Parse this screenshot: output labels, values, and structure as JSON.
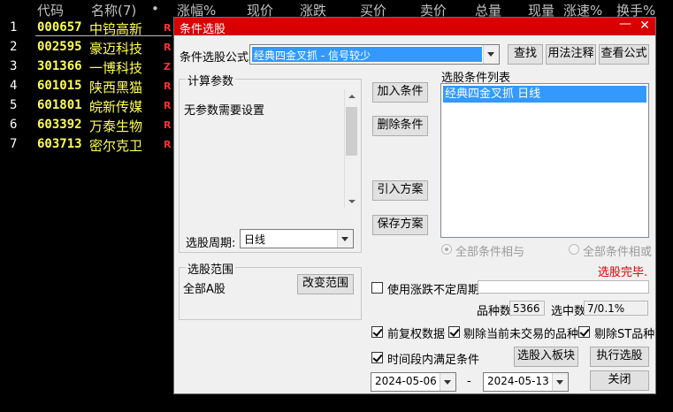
{
  "list_header": {
    "code": "代码",
    "name": "名称(7)",
    "dot": "•",
    "change_pct": "涨幅%",
    "price": "现价",
    "change": "涨跌",
    "bid": "买价",
    "ask": "卖价",
    "volume": "总量",
    "cur_volume": "现量",
    "speed": "涨速%",
    "turnover": "换手%"
  },
  "stocks": [
    {
      "idx": "1",
      "code": "000657",
      "name": "中钨高新",
      "flag": "R"
    },
    {
      "idx": "2",
      "code": "002595",
      "name": "豪迈科技",
      "flag": "R"
    },
    {
      "idx": "3",
      "code": "301366",
      "name": "一博科技",
      "flag": "Z"
    },
    {
      "idx": "4",
      "code": "601015",
      "name": "陕西黑猫",
      "flag": "R"
    },
    {
      "idx": "5",
      "code": "601801",
      "name": "皖新传媒",
      "flag": "R"
    },
    {
      "idx": "6",
      "code": "603392",
      "name": "万泰生物",
      "flag": "R"
    },
    {
      "idx": "7",
      "code": "603713",
      "name": "密尔克卫",
      "flag": "R"
    }
  ],
  "dialog": {
    "title": "条件选股",
    "minimize": "—",
    "close": "✕",
    "formula_label": "条件选股公式",
    "formula_value": "经典四金叉抓 - 信号较少",
    "find_btn": "查找",
    "usage_btn": "用法注释",
    "view_formula_btn": "查看公式",
    "params_group": "计算参数",
    "params_text": "无参数需要设置",
    "period_label": "选股周期:",
    "period_value": "日线",
    "add_cond_btn": "加入条件",
    "del_cond_btn": "删除条件",
    "import_plan_btn": "引入方案",
    "save_plan_btn": "保存方案",
    "cond_list_label": "选股条件列表",
    "cond_items": [
      "经典四金叉抓  日线"
    ],
    "radio_and": "全部条件相与",
    "radio_or": "全部条件相或",
    "status": "选股完毕.",
    "range_group": "选股范围",
    "range_value": "全部A股",
    "change_range_btn": "改变范围",
    "use_variable_period": "使用涨跌不定周期",
    "variable_period_value": "",
    "count_label": "品种数",
    "count_value": "5366",
    "selected_label": "选中数",
    "selected_value": "7/0.1%",
    "fq_label": "前复权数据",
    "exclude_untraded_label": "剔除当前未交易的品种",
    "exclude_st_label": "剔除ST品种",
    "time_range_label": "时间段内满足条件",
    "add_to_block_btn": "选股入板块",
    "execute_btn": "执行选股",
    "date_from": "2024-05-06",
    "date_sep": "-",
    "date_to": "2024-05-13",
    "close_btn": "关闭"
  },
  "colors": {
    "title_bar": "#d80000",
    "stock_text": "#ffff54",
    "selection": "#3399ff",
    "status": "#d80000"
  }
}
